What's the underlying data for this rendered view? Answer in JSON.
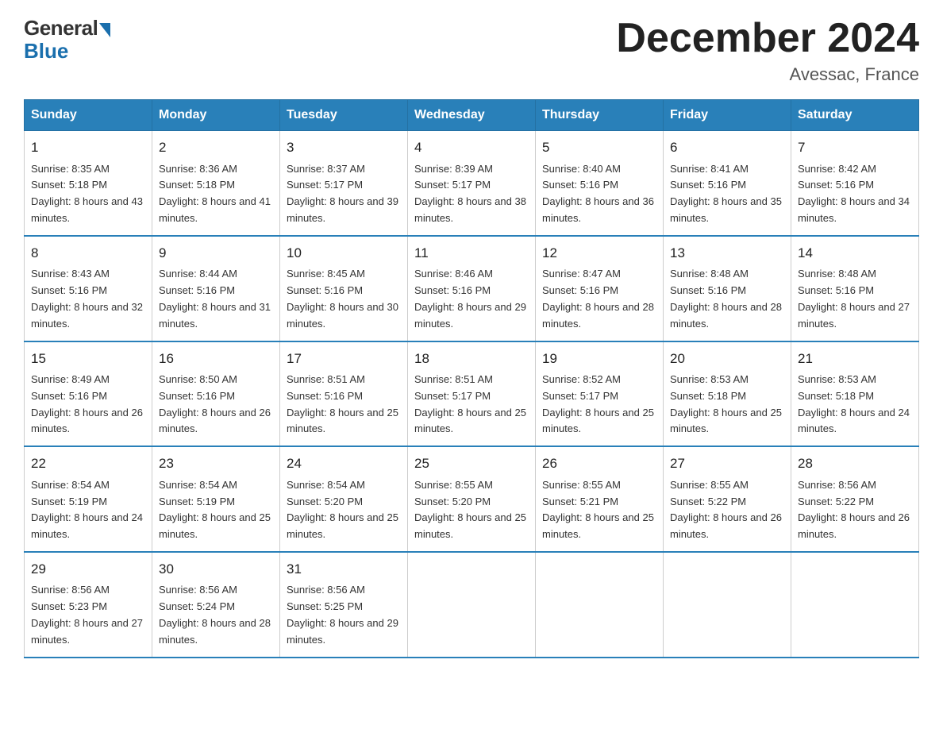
{
  "logo": {
    "general": "General",
    "blue": "Blue"
  },
  "header": {
    "title": "December 2024",
    "subtitle": "Avessac, France"
  },
  "days_of_week": [
    "Sunday",
    "Monday",
    "Tuesday",
    "Wednesday",
    "Thursday",
    "Friday",
    "Saturday"
  ],
  "weeks": [
    [
      {
        "day": "1",
        "sunrise": "8:35 AM",
        "sunset": "5:18 PM",
        "daylight": "8 hours and 43 minutes."
      },
      {
        "day": "2",
        "sunrise": "8:36 AM",
        "sunset": "5:18 PM",
        "daylight": "8 hours and 41 minutes."
      },
      {
        "day": "3",
        "sunrise": "8:37 AM",
        "sunset": "5:17 PM",
        "daylight": "8 hours and 39 minutes."
      },
      {
        "day": "4",
        "sunrise": "8:39 AM",
        "sunset": "5:17 PM",
        "daylight": "8 hours and 38 minutes."
      },
      {
        "day": "5",
        "sunrise": "8:40 AM",
        "sunset": "5:16 PM",
        "daylight": "8 hours and 36 minutes."
      },
      {
        "day": "6",
        "sunrise": "8:41 AM",
        "sunset": "5:16 PM",
        "daylight": "8 hours and 35 minutes."
      },
      {
        "day": "7",
        "sunrise": "8:42 AM",
        "sunset": "5:16 PM",
        "daylight": "8 hours and 34 minutes."
      }
    ],
    [
      {
        "day": "8",
        "sunrise": "8:43 AM",
        "sunset": "5:16 PM",
        "daylight": "8 hours and 32 minutes."
      },
      {
        "day": "9",
        "sunrise": "8:44 AM",
        "sunset": "5:16 PM",
        "daylight": "8 hours and 31 minutes."
      },
      {
        "day": "10",
        "sunrise": "8:45 AM",
        "sunset": "5:16 PM",
        "daylight": "8 hours and 30 minutes."
      },
      {
        "day": "11",
        "sunrise": "8:46 AM",
        "sunset": "5:16 PM",
        "daylight": "8 hours and 29 minutes."
      },
      {
        "day": "12",
        "sunrise": "8:47 AM",
        "sunset": "5:16 PM",
        "daylight": "8 hours and 28 minutes."
      },
      {
        "day": "13",
        "sunrise": "8:48 AM",
        "sunset": "5:16 PM",
        "daylight": "8 hours and 28 minutes."
      },
      {
        "day": "14",
        "sunrise": "8:48 AM",
        "sunset": "5:16 PM",
        "daylight": "8 hours and 27 minutes."
      }
    ],
    [
      {
        "day": "15",
        "sunrise": "8:49 AM",
        "sunset": "5:16 PM",
        "daylight": "8 hours and 26 minutes."
      },
      {
        "day": "16",
        "sunrise": "8:50 AM",
        "sunset": "5:16 PM",
        "daylight": "8 hours and 26 minutes."
      },
      {
        "day": "17",
        "sunrise": "8:51 AM",
        "sunset": "5:16 PM",
        "daylight": "8 hours and 25 minutes."
      },
      {
        "day": "18",
        "sunrise": "8:51 AM",
        "sunset": "5:17 PM",
        "daylight": "8 hours and 25 minutes."
      },
      {
        "day": "19",
        "sunrise": "8:52 AM",
        "sunset": "5:17 PM",
        "daylight": "8 hours and 25 minutes."
      },
      {
        "day": "20",
        "sunrise": "8:53 AM",
        "sunset": "5:18 PM",
        "daylight": "8 hours and 25 minutes."
      },
      {
        "day": "21",
        "sunrise": "8:53 AM",
        "sunset": "5:18 PM",
        "daylight": "8 hours and 24 minutes."
      }
    ],
    [
      {
        "day": "22",
        "sunrise": "8:54 AM",
        "sunset": "5:19 PM",
        "daylight": "8 hours and 24 minutes."
      },
      {
        "day": "23",
        "sunrise": "8:54 AM",
        "sunset": "5:19 PM",
        "daylight": "8 hours and 25 minutes."
      },
      {
        "day": "24",
        "sunrise": "8:54 AM",
        "sunset": "5:20 PM",
        "daylight": "8 hours and 25 minutes."
      },
      {
        "day": "25",
        "sunrise": "8:55 AM",
        "sunset": "5:20 PM",
        "daylight": "8 hours and 25 minutes."
      },
      {
        "day": "26",
        "sunrise": "8:55 AM",
        "sunset": "5:21 PM",
        "daylight": "8 hours and 25 minutes."
      },
      {
        "day": "27",
        "sunrise": "8:55 AM",
        "sunset": "5:22 PM",
        "daylight": "8 hours and 26 minutes."
      },
      {
        "day": "28",
        "sunrise": "8:56 AM",
        "sunset": "5:22 PM",
        "daylight": "8 hours and 26 minutes."
      }
    ],
    [
      {
        "day": "29",
        "sunrise": "8:56 AM",
        "sunset": "5:23 PM",
        "daylight": "8 hours and 27 minutes."
      },
      {
        "day": "30",
        "sunrise": "8:56 AM",
        "sunset": "5:24 PM",
        "daylight": "8 hours and 28 minutes."
      },
      {
        "day": "31",
        "sunrise": "8:56 AM",
        "sunset": "5:25 PM",
        "daylight": "8 hours and 29 minutes."
      },
      null,
      null,
      null,
      null
    ]
  ],
  "labels": {
    "sunrise": "Sunrise:",
    "sunset": "Sunset:",
    "daylight": "Daylight:"
  }
}
